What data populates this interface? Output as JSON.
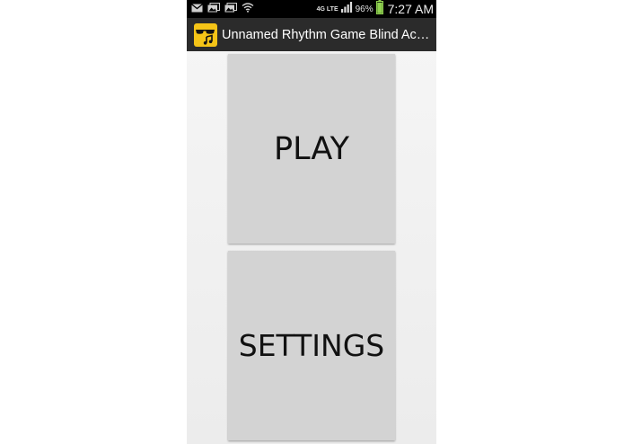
{
  "status_bar": {
    "network": "4G LTE",
    "battery_percent": "96%",
    "battery_level": 0.96,
    "time": "7:27 AM",
    "icons": [
      "gmail-icon",
      "photo-notification-icon",
      "photo-notification-icon",
      "wifi-icon",
      "signal-icon",
      "battery-icon"
    ]
  },
  "action_bar": {
    "title": "Unnamed Rhythm Game Blind Acce..."
  },
  "main": {
    "play_label": "PLAY",
    "settings_label": "SETTINGS"
  },
  "colors": {
    "status_bar_bg": "#000000",
    "action_bar_bg": "#2b2b2b",
    "button_bg": "#d3d3d3",
    "app_icon_bg": "#f5c417"
  }
}
